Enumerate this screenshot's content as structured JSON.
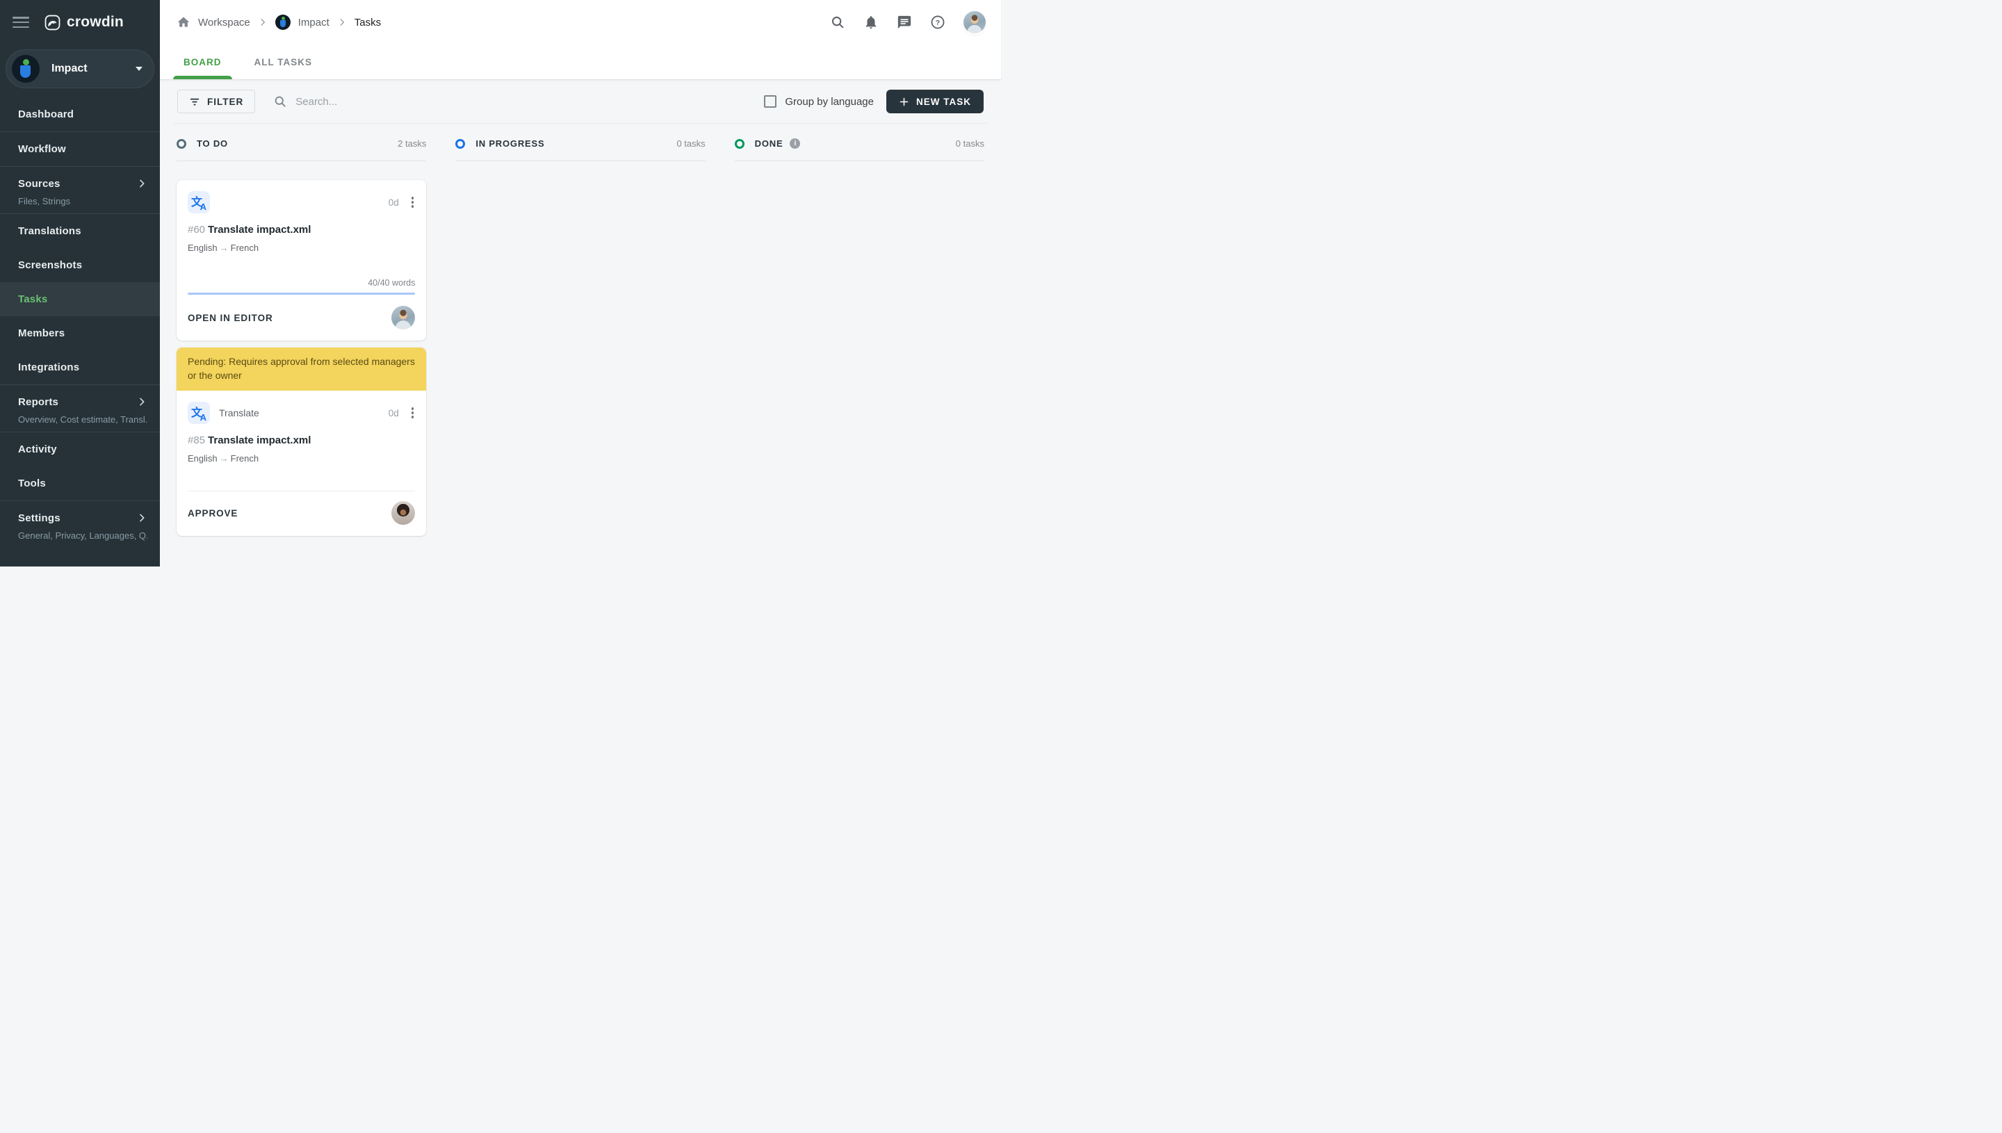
{
  "app": {
    "logo_text": "crowdin"
  },
  "theme": {
    "sidebar_bg": "#263238",
    "accent_green": "#43a047",
    "active_item_green": "#6cbf73",
    "banner_yellow": "#f3d45c",
    "progress_blue": "#a9c7f8",
    "new_task_bg": "#28343c",
    "translate_icon_blue": "#1a73e8",
    "translate_icon_bg": "#e8f0fe"
  },
  "sidebar": {
    "project": {
      "name": "Impact"
    },
    "items": [
      {
        "label": "Dashboard"
      },
      {
        "label": "Workflow"
      },
      {
        "label": "Sources",
        "subtitle": "Files, Strings"
      },
      {
        "label": "Translations"
      },
      {
        "label": "Screenshots"
      },
      {
        "label": "Tasks",
        "active": true
      },
      {
        "label": "Members"
      },
      {
        "label": "Integrations"
      },
      {
        "label": "Reports",
        "subtitle": "Overview, Cost estimate, Transl..."
      },
      {
        "label": "Activity"
      },
      {
        "label": "Tools"
      },
      {
        "label": "Settings",
        "subtitle": "General, Privacy, Languages, Q..."
      }
    ]
  },
  "breadcrumb": {
    "items": [
      "Workspace",
      "Impact",
      "Tasks"
    ]
  },
  "tabs": [
    {
      "label": "BOARD",
      "active": true
    },
    {
      "label": "ALL TASKS",
      "active": false
    }
  ],
  "toolbar": {
    "filter_label": "FILTER",
    "search_placeholder": "Search...",
    "group_by_label": "Group by language",
    "new_task_label": "NEW TASK"
  },
  "board": {
    "columns": [
      {
        "title": "TO DO",
        "count": "2 tasks",
        "color": "#546e7a"
      },
      {
        "title": "IN PROGRESS",
        "count": "0 tasks",
        "color": "#1a73e8"
      },
      {
        "title": "DONE",
        "count": "0 tasks",
        "color": "#00995c",
        "info": "i"
      }
    ]
  },
  "cards": {
    "card1": {
      "id": "#60",
      "title": "Translate impact.xml",
      "lang_source": "English",
      "lang_arrow": "→",
      "lang_target": "French",
      "duration": "0d",
      "words": "40/40 words",
      "action": "OPEN IN EDITOR"
    },
    "card2": {
      "banner": "Pending: Requires approval from selected managers or the owner",
      "type_label": "Translate",
      "id": "#85",
      "title": "Translate impact.xml",
      "lang_source": "English",
      "lang_arrow": "→",
      "lang_target": "French",
      "duration": "0d",
      "action": "APPROVE"
    }
  }
}
